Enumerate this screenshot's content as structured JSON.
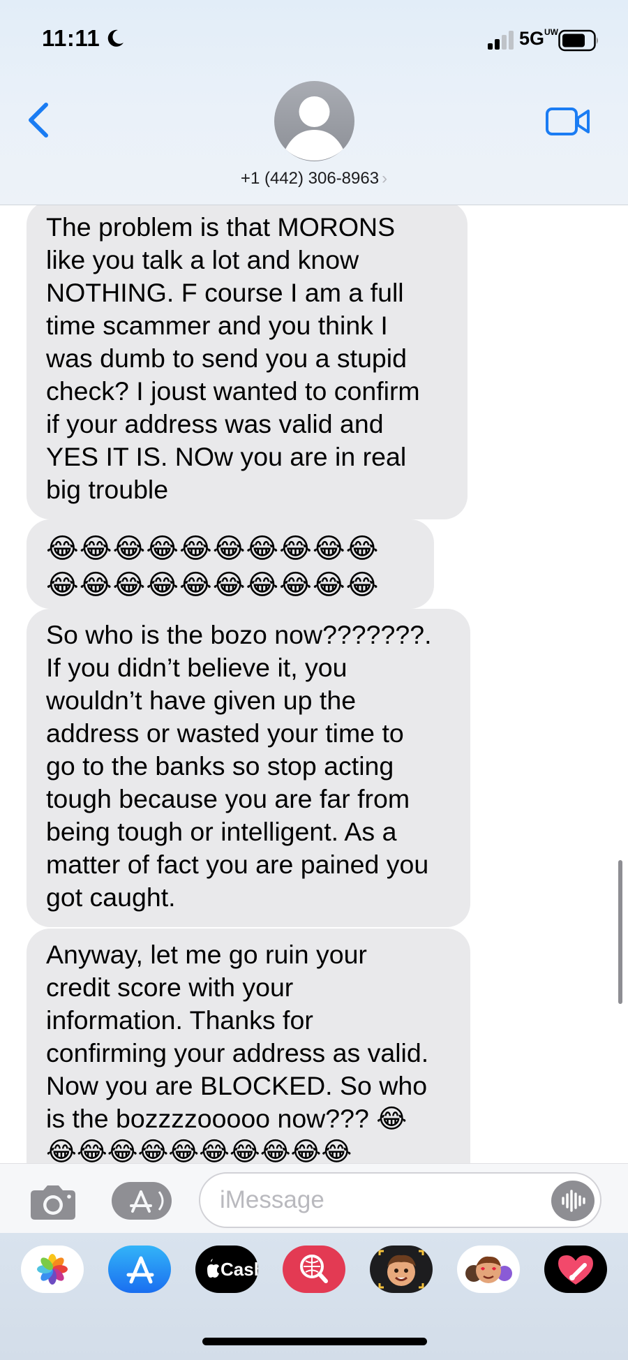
{
  "status_bar": {
    "time": "11:11",
    "network": "5G",
    "network_suffix": "UW",
    "icons": [
      "moon-icon",
      "signal-icon",
      "battery-icon"
    ]
  },
  "header": {
    "contact": "+1 (442) 306-8963",
    "icons": [
      "back-chevron-icon",
      "person-avatar-icon",
      "video-camera-icon"
    ],
    "accent_color": "#1a7cf3"
  },
  "messages": [
    {
      "sender": "incoming",
      "text": "The problem is that MORONS\nlike you talk a lot and know\nNOTHING. F course I am a full\ntime scammer and you think I\nwas dumb to send you a stupid\ncheck? I joust wanted to confirm\nif your address was valid and\nYES IT IS. NOw you are in real\nbig trouble"
    },
    {
      "sender": "incoming",
      "text": "😂😂😂😂😂😂😂😂😂😂\n😂😂😂😂😂😂😂😂😂😂"
    },
    {
      "sender": "incoming",
      "text": "So who is the bozo now???????.\nIf you didn’t believe it, you\nwouldn’t have given up the\naddress or wasted your time to\ngo to the banks so stop acting\ntough because you are far from\nbeing tough or intelligent. As a\nmatter of fact you are pained you\ngot caught."
    },
    {
      "sender": "incoming",
      "text": "Anyway, let me go ruin your\ncredit score with your\ninformation. Thanks for\nconfirming your address as valid.\nNow you are BLOCKED. So who\nis the bozzzzooooo now??? 😂\n😂😂😂😂😂😂😂😂😂😂"
    }
  ],
  "bubble_color": "#e9e9eb",
  "input": {
    "placeholder": "iMessage",
    "value": "",
    "icons": [
      "camera-icon",
      "app-store-icon",
      "audio-waveform-icon"
    ]
  },
  "app_drawer": {
    "apps": [
      {
        "name": "photos-app-icon",
        "label": ""
      },
      {
        "name": "app-store-app-icon",
        "label": ""
      },
      {
        "name": "apple-cash-app-icon",
        "label": "Cash"
      },
      {
        "name": "image-search-app-icon",
        "label": ""
      },
      {
        "name": "memoji-app-icon",
        "label": ""
      },
      {
        "name": "memoji-stickers-app-icon",
        "label": ""
      },
      {
        "name": "digital-touch-app-icon",
        "label": ""
      }
    ]
  }
}
